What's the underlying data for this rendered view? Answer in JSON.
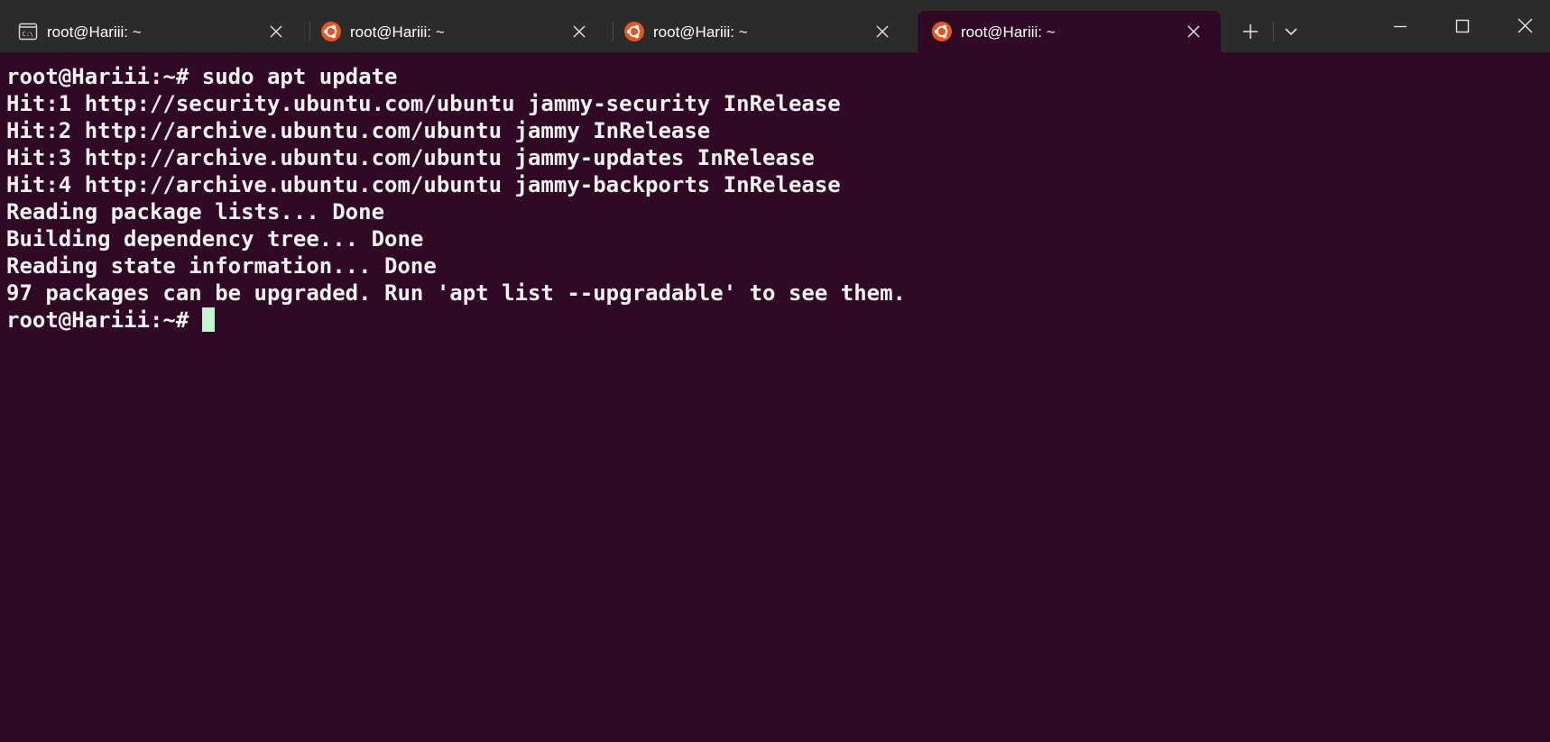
{
  "window": {
    "tabs": [
      {
        "label": "root@Hariii: ~",
        "icon": "cmd-icon",
        "active": false
      },
      {
        "label": "root@Hariii: ~",
        "icon": "ubuntu-icon",
        "active": false
      },
      {
        "label": "root@Hariii: ~",
        "icon": "ubuntu-icon",
        "active": false
      },
      {
        "label": "root@Hariii: ~",
        "icon": "ubuntu-icon",
        "active": true
      }
    ],
    "new_tab_icon": "plus-icon",
    "dropdown_icon": "chevron-down-icon",
    "caption_buttons": [
      "minimize-icon",
      "maximize-icon",
      "close-icon"
    ]
  },
  "terminal": {
    "lines": [
      "root@Hariii:~# sudo apt update",
      "Hit:1 http://security.ubuntu.com/ubuntu jammy-security InRelease",
      "Hit:2 http://archive.ubuntu.com/ubuntu jammy InRelease",
      "Hit:3 http://archive.ubuntu.com/ubuntu jammy-updates InRelease",
      "Hit:4 http://archive.ubuntu.com/ubuntu jammy-backports InRelease",
      "Reading package lists... Done",
      "Building dependency tree... Done",
      "Reading state information... Done",
      "97 packages can be upgraded. Run 'apt list --upgradable' to see them."
    ],
    "prompt": "root@Hariii:~# ",
    "colors": {
      "background": "#300a24",
      "foreground": "#f2f2f2",
      "cursor": "#c2f5d2",
      "ubuntu_orange": "#e95420"
    }
  }
}
